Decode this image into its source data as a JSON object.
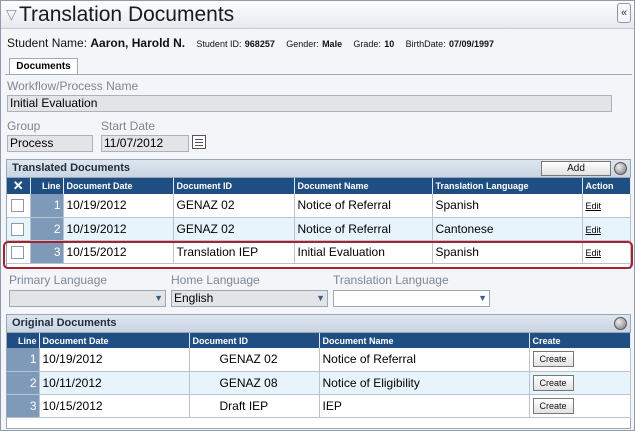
{
  "title": "Translation Documents",
  "collapse_glyph": "«",
  "student": {
    "name_label": "Student Name:",
    "name": "Aaron, Harold N.",
    "id_label": "Student ID:",
    "id": "968257",
    "gender_label": "Gender:",
    "gender": "Male",
    "grade_label": "Grade:",
    "grade": "10",
    "birth_label": "BirthDate:",
    "birth": "07/09/1997"
  },
  "tab": "Documents",
  "workflow": {
    "label": "Workflow/Process Name",
    "value": "Initial Evaluation"
  },
  "group": {
    "label": "Group",
    "value": "Process"
  },
  "start_date": {
    "label": "Start Date",
    "value": "11/07/2012"
  },
  "translated": {
    "title": "Translated Documents",
    "add_label": "Add",
    "columns": {
      "x": "✕",
      "line": "Line",
      "date": "Document Date",
      "id": "Document ID",
      "name": "Document Name",
      "lang": "Translation Language",
      "action": "Action"
    },
    "rows": [
      {
        "line": "1",
        "date": "10/19/2012",
        "id": "GENAZ 02",
        "name": "Notice of Referral",
        "lang": "Spanish",
        "action": "Edit"
      },
      {
        "line": "2",
        "date": "10/19/2012",
        "id": "GENAZ 02",
        "name": "Notice of Referral",
        "lang": "Cantonese",
        "action": "Edit"
      },
      {
        "line": "3",
        "date": "10/15/2012",
        "id": "Translation IEP",
        "name": "Initial Evaluation",
        "lang": "Spanish",
        "action": "Edit"
      }
    ]
  },
  "languages": {
    "primary": {
      "label": "Primary Language",
      "value": ""
    },
    "home": {
      "label": "Home Language",
      "value": "English"
    },
    "translation": {
      "label": "Translation Language",
      "value": ""
    }
  },
  "original": {
    "title": "Original Documents",
    "columns": {
      "line": "Line",
      "date": "Document Date",
      "id": "Document ID",
      "name": "Document Name",
      "create": "Create"
    },
    "rows": [
      {
        "line": "1",
        "date": "10/19/2012",
        "id": "GENAZ 02",
        "name": "Notice of Referral",
        "create": "Create"
      },
      {
        "line": "2",
        "date": "10/11/2012",
        "id": "GENAZ 08",
        "name": "Notice of Eligibility",
        "create": "Create"
      },
      {
        "line": "3",
        "date": "10/15/2012",
        "id": "Draft IEP",
        "name": "IEP",
        "create": "Create"
      }
    ]
  },
  "colors": {
    "header": "#1f4f82",
    "line_cell": "#7e9ab8",
    "alt_row": "#e8f4fb",
    "highlight": "#a32430"
  }
}
